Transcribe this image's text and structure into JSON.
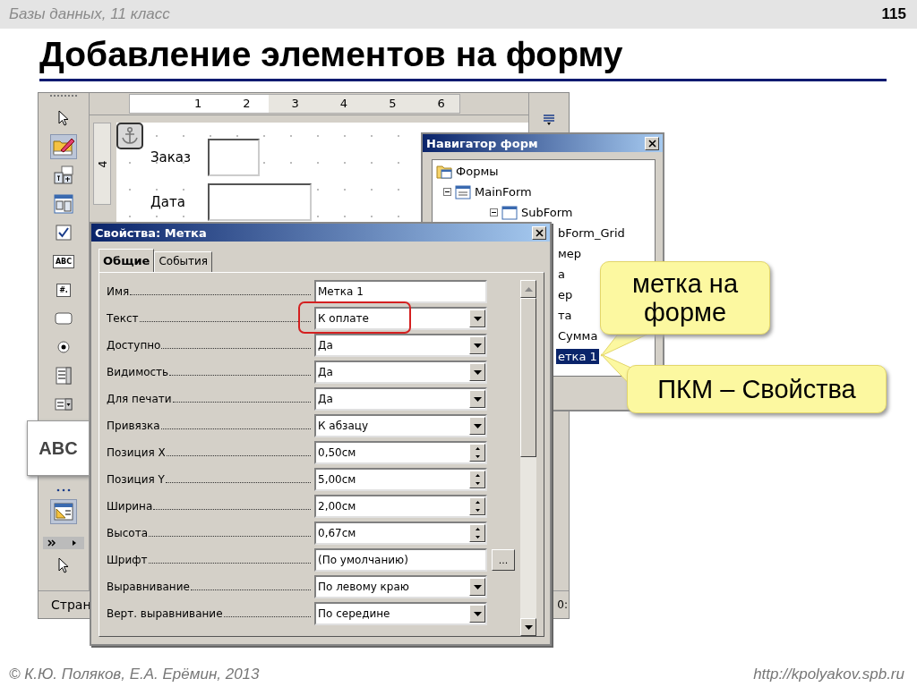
{
  "header": {
    "course": "Базы данных, 11 класс",
    "page": "115"
  },
  "title": "Добавление элементов на форму",
  "editor": {
    "toolbar": [
      {
        "kind": "pointer",
        "selected": false
      },
      {
        "kind": "design",
        "selected": true
      },
      {
        "kind": "form-design",
        "selected": false
      },
      {
        "kind": "navigator",
        "selected": false
      },
      {
        "kind": "checkbox",
        "selected": false
      },
      {
        "kind": "label",
        "text": "ABC",
        "selected": false
      },
      {
        "kind": "formatted",
        "text": "#.",
        "selected": false
      },
      {
        "kind": "pushbutton",
        "selected": false
      },
      {
        "kind": "radio",
        "selected": false
      },
      {
        "kind": "listbox",
        "selected": false
      },
      {
        "kind": "combobox",
        "selected": false
      },
      {
        "kind": "more",
        "selected": false
      },
      {
        "kind": "formprops",
        "selected": true
      },
      {
        "kind": "expand",
        "selected": false
      },
      {
        "kind": "pointer",
        "selected": false
      }
    ],
    "zoom_popup": {
      "text": "ABC"
    },
    "ruler": [
      "1",
      "2",
      "3",
      "4",
      "5",
      "6"
    ],
    "vruler": "4",
    "form_fields": [
      {
        "label": "Заказ"
      },
      {
        "label": "Дата"
      }
    ],
    "status": "Стран",
    "status_right": "0:"
  },
  "navigator": {
    "title": "Навигатор форм",
    "tree": [
      {
        "label": "Формы",
        "selected": false,
        "children": [
          {
            "label": "MainForm",
            "expanded": true,
            "selected": false,
            "children": [
              {
                "label": "SubForm",
                "expanded": true,
                "selected": false,
                "children": [
                  {
                    "label": "bForm_Grid",
                    "selected": false
                  },
                  {
                    "label": "мер",
                    "selected": false
                  },
                  {
                    "label": "а",
                    "selected": false
                  },
                  {
                    "label": "ер",
                    "selected": false
                  },
                  {
                    "label": "та",
                    "selected": false
                  },
                  {
                    "label": "Сумма",
                    "selected": false
                  },
                  {
                    "label": "етка 1",
                    "selected": true
                  }
                ]
              }
            ]
          }
        ]
      }
    ]
  },
  "properties": {
    "title": "Свойства: Метка",
    "tabs": [
      {
        "label": "Общие",
        "selected": true
      },
      {
        "label": "События",
        "selected": false
      }
    ],
    "rows": [
      {
        "label": "Имя",
        "kind": "text",
        "value": "Метка 1",
        "highlighted": false
      },
      {
        "label": "Текст",
        "kind": "dropdown",
        "value": "К оплате",
        "highlighted": true
      },
      {
        "label": "Доступно",
        "kind": "dropdown",
        "value": "Да",
        "highlighted": false
      },
      {
        "label": "Видимость",
        "kind": "dropdown",
        "value": "Да",
        "highlighted": false
      },
      {
        "label": "Для печати",
        "kind": "dropdown",
        "value": "Да",
        "highlighted": false
      },
      {
        "label": "Привязка",
        "kind": "dropdown",
        "value": "К абзацу",
        "highlighted": false
      },
      {
        "label": "Позиция X",
        "kind": "spin",
        "value": "0,50см",
        "highlighted": false
      },
      {
        "label": "Позиция Y",
        "kind": "spin",
        "value": "5,00см",
        "highlighted": false
      },
      {
        "label": "Ширина",
        "kind": "spin",
        "value": "2,00см",
        "highlighted": false
      },
      {
        "label": "Высота",
        "kind": "spin",
        "value": "0,67см",
        "highlighted": false
      },
      {
        "label": "Шрифт",
        "kind": "browse",
        "value": "(По умолчанию)",
        "browse": "...",
        "highlighted": false
      },
      {
        "label": "Выравнивание",
        "kind": "dropdown",
        "value": "По левому краю",
        "highlighted": false
      },
      {
        "label": "Верт. выравнивание",
        "kind": "dropdown",
        "value": "По середине",
        "highlighted": false
      }
    ]
  },
  "callouts": [
    {
      "text": "метка на форме"
    },
    {
      "text": "ПКМ – Свойства"
    }
  ],
  "footer": {
    "authors": "© К.Ю. Поляков, Е.А. Ерёмин, 2013",
    "url": "http://kpolyakov.spb.ru"
  }
}
